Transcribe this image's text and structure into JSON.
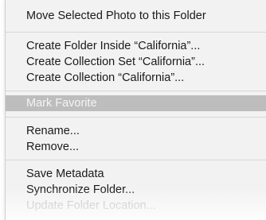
{
  "menu": {
    "items": [
      {
        "label": "Move Selected Photo to this Folder"
      },
      {
        "label": "Create Folder Inside “California”..."
      },
      {
        "label": "Create Collection Set “California”..."
      },
      {
        "label": "Create Collection “California”..."
      },
      {
        "label": "Mark Favorite"
      },
      {
        "label": "Rename..."
      },
      {
        "label": "Remove..."
      },
      {
        "label": "Save Metadata"
      },
      {
        "label": "Synchronize Folder..."
      },
      {
        "label": "Update Folder Location..."
      }
    ]
  }
}
